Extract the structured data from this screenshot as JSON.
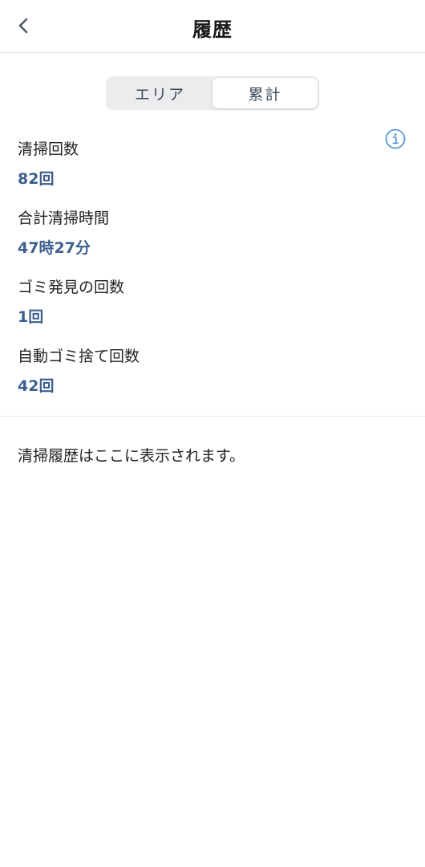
{
  "header": {
    "title": "履歴"
  },
  "tabs": [
    {
      "label": "エリア",
      "active": false
    },
    {
      "label": "累計",
      "active": true
    }
  ],
  "stats": [
    {
      "label": "清掃回数",
      "value": "82回"
    },
    {
      "label": "合計清掃時間",
      "value": "47時27分"
    },
    {
      "label": "ゴミ発見の回数",
      "value": "1回"
    },
    {
      "label": "自動ゴミ捨て回数",
      "value": "42回"
    }
  ],
  "history": {
    "empty_message": "清掃履歴はここに表示されます。"
  },
  "colors": {
    "accent": "#3d5f8f",
    "info_icon": "#5a9bd5",
    "segment_bg": "#ececee"
  },
  "icons": {
    "back": "chevron-left-icon",
    "info": "info-circle-icon"
  }
}
